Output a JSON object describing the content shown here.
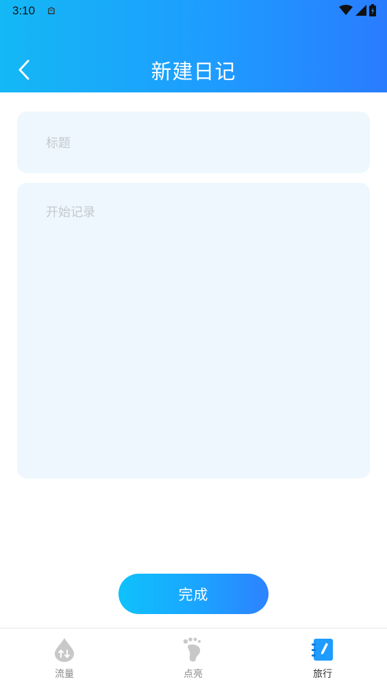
{
  "status_bar": {
    "time": "3:10"
  },
  "header": {
    "title": "新建日记",
    "back_icon": "chevron-left-icon"
  },
  "form": {
    "title_placeholder": "标题",
    "title_value": "",
    "content_placeholder": "开始记录",
    "content_value": ""
  },
  "done_button": {
    "label": "完成"
  },
  "tabs": [
    {
      "label": "流量",
      "icon": "traffic-drop-icon",
      "active": false
    },
    {
      "label": "点亮",
      "icon": "footprint-icon",
      "active": false
    },
    {
      "label": "旅行",
      "icon": "notebook-pen-icon",
      "active": true
    }
  ],
  "colors": {
    "header_gradient_start": "#14b8f5",
    "header_gradient_end": "#2a7cff",
    "field_background": "#eef7fe",
    "placeholder": "#c4c9cf",
    "active_tab_icon": "#1e9cff",
    "inactive_tab_icon": "#c8c8c8"
  }
}
